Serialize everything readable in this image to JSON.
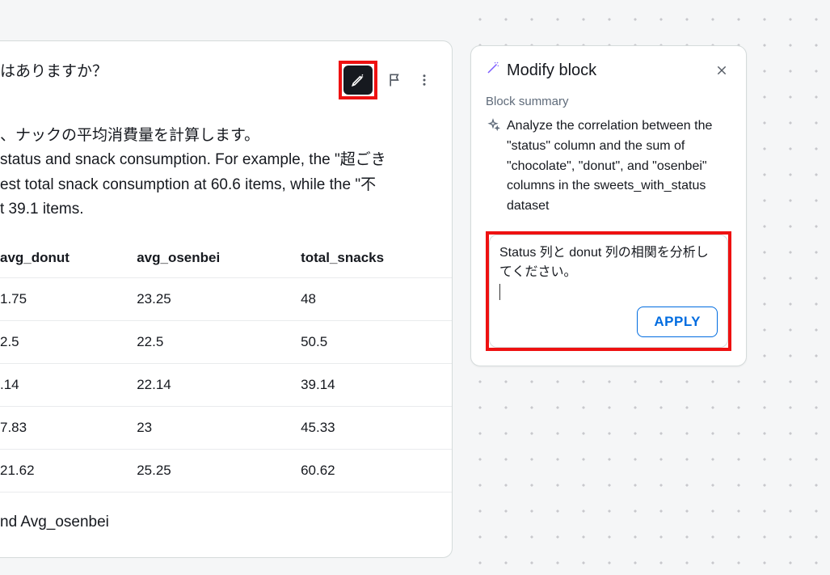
{
  "main": {
    "headerText": "はありますか？",
    "bodyText": "、ナックの平均消費量を計算します。\nstatus and snack consumption. For example, the \"超ごき\nest total snack consumption at 60.6 items, while the \"不\nt 39.1 items.",
    "footerText": "nd Avg_osenbei"
  },
  "table": {
    "headers": [
      "avg_donut",
      "avg_osenbei",
      "total_snacks"
    ],
    "rows": [
      [
        "1.75",
        "23.25",
        "48"
      ],
      [
        "2.5",
        "22.5",
        "50.5"
      ],
      [
        ".14",
        "22.14",
        "39.14"
      ],
      [
        "7.83",
        "23",
        "45.33"
      ],
      [
        "21.62",
        "25.25",
        "60.62"
      ]
    ]
  },
  "panel": {
    "title": "Modify block",
    "summaryLabel": "Block summary",
    "summaryText": "Analyze the correlation between the \"status\" column and the sum of \"chocolate\", \"donut\", and \"osenbei\" columns in the sweets_with_status dataset",
    "inputText": "Status 列と donut 列の相関を分析してください。",
    "applyLabel": "APPLY"
  }
}
